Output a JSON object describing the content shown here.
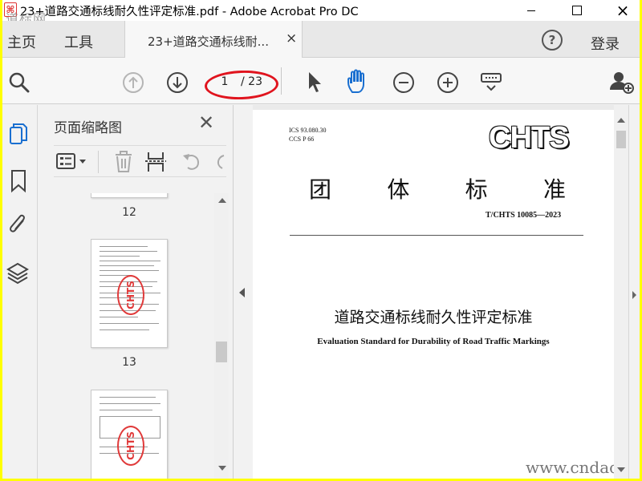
{
  "window": {
    "title": "23+道路交通标线耐久性评定标准.pdf - Adobe Acrobat Pro DC",
    "watermark_top": "道标网",
    "watermark_bottom": "www.cndao.com"
  },
  "menu": {
    "home": "主页",
    "tools": "工具",
    "tab_label": "23+道路交通标线耐...",
    "tab_close": "×",
    "help": "?",
    "login": "登录"
  },
  "toolbar": {
    "current_page": "1",
    "total_pages": "/ 23"
  },
  "thumbnails": {
    "title": "页面缩略图",
    "close": "✕",
    "pages": [
      "12",
      "13"
    ]
  },
  "document": {
    "ics": "ICS 93.080.30",
    "ccs": "CCS P 66",
    "brand": "CHTS",
    "group_chars": [
      "团",
      "体",
      "标",
      "准"
    ],
    "code": "T/CHTS 10085—2023",
    "title_cn": "道路交通标线耐久性评定标准",
    "title_en": "Evaluation Standard for Durability of Road Traffic Markings",
    "stamp_text": "CHTS"
  },
  "colors": {
    "highlight_ellipse": "#e0141e",
    "frame": "#ffff00",
    "accent_blue": "#1a6fd0"
  }
}
